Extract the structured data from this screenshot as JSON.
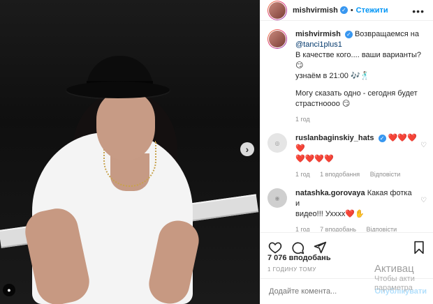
{
  "post": {
    "username": "mishvirmish",
    "follow_label": "Стежити",
    "caption": {
      "line1": "Возвращаемся на",
      "mention": "@tanci1plus1",
      "line2": "В качестве кого.... ваши варианты?😏",
      "line3": "узнаём в 21:00 🎶🕺🏻",
      "line4": "Могу сказать одно - сегодня будет",
      "line5": "страстноооо 😏",
      "time": "1 год"
    }
  },
  "comments": [
    {
      "username": "ruslanbaginskiy_hats",
      "text": "❤️❤️❤️❤️",
      "text2": "❤️❤️❤️❤️",
      "time": "1 год",
      "likes": "1 вподобання",
      "reply": "Відповісти"
    },
    {
      "username": "natashka.gorovaya",
      "text": "Какая фотка и",
      "text2": "видео!!! Ухххх❤️✋",
      "time": "1 год",
      "likes": "7 вподобань",
      "reply": "Відповісти"
    }
  ],
  "footer": {
    "likes": "7 076 вподобань",
    "time_ago": "1 ГОДИНУ ТОМУ",
    "comment_placeholder": "Додайте комента...",
    "post_label": "Опублікувати"
  },
  "overlay": {
    "line1": "Активац",
    "line2": "Чтобы акти",
    "line3": "параметра"
  }
}
